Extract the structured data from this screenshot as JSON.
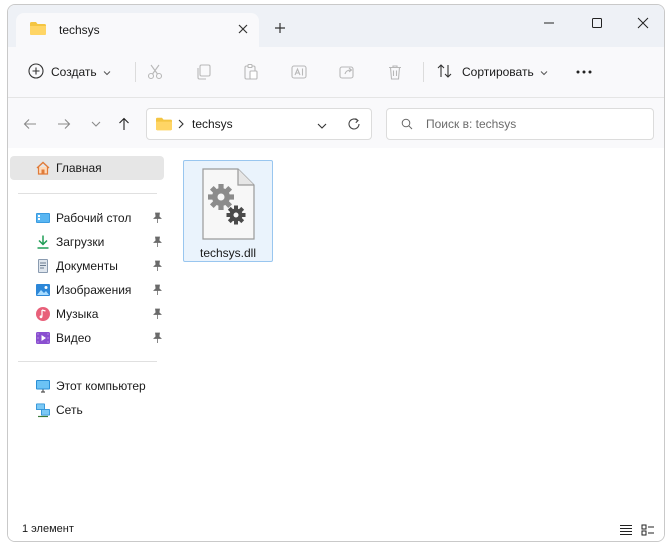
{
  "window": {
    "tab_title": "techsys",
    "colors": {
      "titlebar": "#eef1f6",
      "accent": "#0067c0",
      "folder": "#f4c542"
    }
  },
  "toolbar": {
    "create_label": "Создать",
    "sort_label": "Сортировать"
  },
  "address": {
    "path": "techsys",
    "search_placeholder": "Поиск в: techsys"
  },
  "sidebar": {
    "home": "Главная",
    "quick_access": [
      {
        "label": "Рабочий стол",
        "icon": "desktop-icon"
      },
      {
        "label": "Загрузки",
        "icon": "download-icon"
      },
      {
        "label": "Документы",
        "icon": "documents-icon"
      },
      {
        "label": "Изображения",
        "icon": "pictures-icon"
      },
      {
        "label": "Музыка",
        "icon": "music-icon"
      },
      {
        "label": "Видео",
        "icon": "video-icon"
      }
    ],
    "this_pc": "Этот компьютер",
    "network": "Сеть"
  },
  "content": {
    "files": [
      {
        "name": "techsys.dll",
        "icon": "dll-gear-file-icon"
      }
    ]
  },
  "status": {
    "item_count": "1 элемент"
  }
}
